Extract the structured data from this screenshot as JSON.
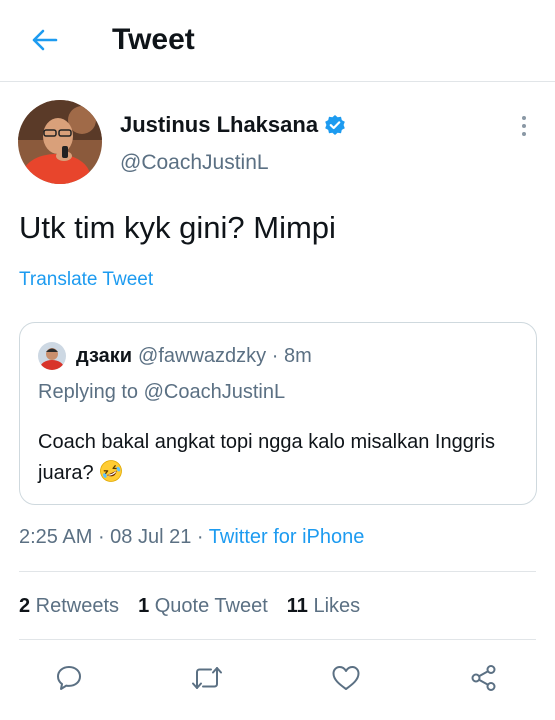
{
  "header": {
    "title": "Tweet",
    "back_icon": "arrow-left-icon"
  },
  "author": {
    "name": "Justinus Lhaksana",
    "handle": "@CoachJustinL",
    "verified_icon": "verified-badge-icon",
    "menu_icon": "more-vertical-icon"
  },
  "tweet": {
    "text": "Utk tim kyk gini? Mimpi",
    "translate_label": "Translate Tweet"
  },
  "quoted": {
    "name": "дзаки",
    "handle": "@fawwazdzky",
    "separator": " · ",
    "age": "8m",
    "reply_line": "Replying to @CoachJustinL",
    "text": "Coach bakal angkat topi ngga kalo misalkan Inggris juara?",
    "emoji_icon": "rolling-laughing-emoji-icon"
  },
  "meta": {
    "time": "2:25 AM",
    "sep1": " · ",
    "date": "08 Jul 21",
    "sep2": " · ",
    "source": "Twitter for iPhone"
  },
  "stats": {
    "retweets_count": "2",
    "retweets_label": " Retweets",
    "quotes_count": "1",
    "quotes_label": " Quote Tweet",
    "likes_count": "11",
    "likes_label": " Likes"
  },
  "actions": [
    "reply-icon",
    "retweet-icon",
    "like-icon",
    "share-icon"
  ],
  "colors": {
    "accent": "#1d9bf0",
    "text": "#0f1419",
    "secondary": "#5b7083",
    "border": "#cfd9de"
  }
}
